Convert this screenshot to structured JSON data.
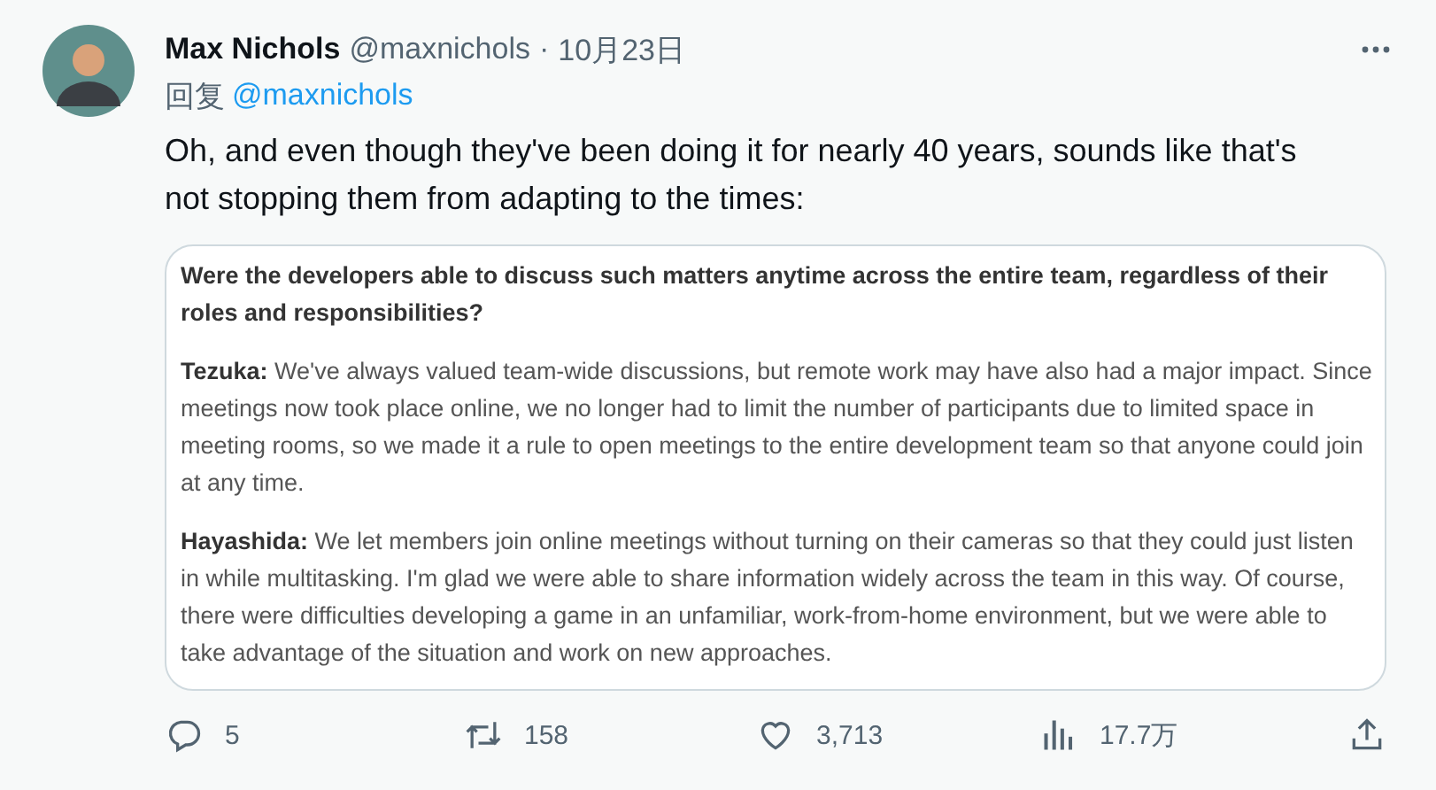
{
  "tweet": {
    "author_name": "Max Nichols",
    "handle": "@maxnichols",
    "separator": "·",
    "date": "10月23日",
    "reply_label": "回复",
    "reply_to": "@maxnichols",
    "text": "Oh, and even though they've been doing it for nearly 40 years, sounds like that's not stopping them from adapting to the times:"
  },
  "quote_card": {
    "question": "Were the developers able to discuss such matters anytime across the entire team, regardless of their roles and responsibilities?",
    "paragraphs": [
      {
        "speaker": "Tezuka:",
        "text": "We've always valued team-wide discussions, but remote work may have also had a major impact. Since meetings now took place online, we no longer had to limit the number of participants due to limited space in meeting rooms, so we made it a rule to open meetings to the entire development team so that anyone could join at any time."
      },
      {
        "speaker": "Hayashida:",
        "text": "We let members join online meetings without turning on their cameras so that they could just listen in while multitasking. I'm glad we were able to share information widely across the team in this way. Of course, there were difficulties developing a game in an unfamiliar, work-from-home environment, but we were able to take advantage of the situation and work on new approaches."
      }
    ]
  },
  "actions": [
    {
      "kind": "reply",
      "count": "5"
    },
    {
      "kind": "retweet",
      "count": "158"
    },
    {
      "kind": "like",
      "count": "3,713"
    },
    {
      "kind": "views",
      "count": "17.7万"
    },
    {
      "kind": "share"
    }
  ]
}
